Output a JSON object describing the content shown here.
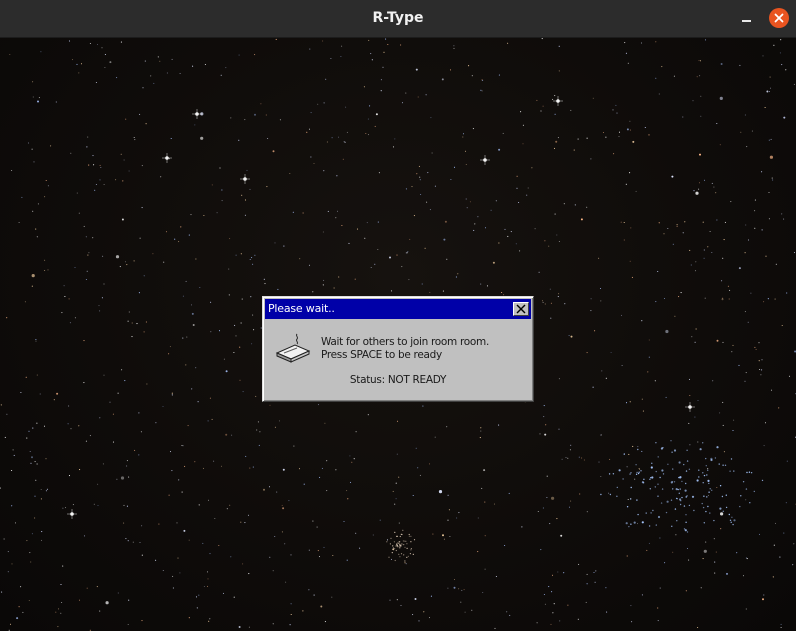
{
  "window": {
    "title": "R-Type",
    "accent_color": "#e95420",
    "icons": [
      "minimize-icon",
      "close-icon"
    ]
  },
  "dialog": {
    "title": "Please wait..",
    "message_line1": "Wait for others to join room room.",
    "message_line2": "Press SPACE to be ready",
    "status": "Status: NOT READY",
    "titlebar_color": "#0000a8",
    "icons": [
      "modem-icon",
      "dialog-close-icon"
    ]
  }
}
